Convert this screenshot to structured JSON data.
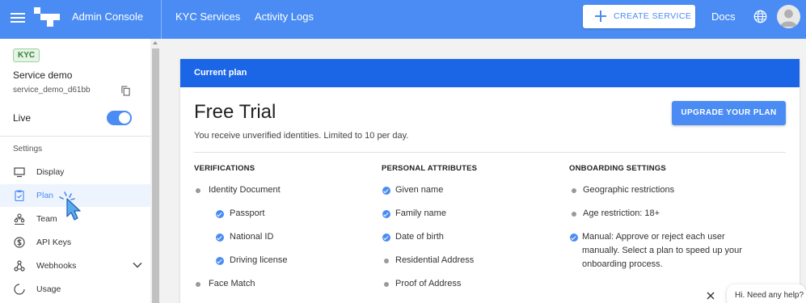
{
  "topbar": {
    "brand": "Admin Console",
    "nav": [
      "KYC Services",
      "Activity Logs"
    ],
    "create_service": "CREATE SERVICE",
    "docs": "Docs",
    "icons": [
      "menu-icon",
      "logo-icon",
      "plus-icon",
      "globe-icon",
      "avatar-icon"
    ]
  },
  "sidebar": {
    "badge": "KYC",
    "service_name": "Service demo",
    "service_id": "service_demo_d61bb",
    "live_label": "Live",
    "live_enabled": true,
    "settings_label": "Settings",
    "items": [
      {
        "label": "Display",
        "icon": "monitor-icon",
        "active": false
      },
      {
        "label": "Plan",
        "icon": "clipboard-icon",
        "active": true
      },
      {
        "label": "Team",
        "icon": "team-icon",
        "active": false
      },
      {
        "label": "API Keys",
        "icon": "dollar-circle-icon",
        "active": false
      },
      {
        "label": "Webhooks",
        "icon": "webhooks-icon",
        "active": false
      },
      {
        "label": "Usage",
        "icon": "usage-icon",
        "active": false
      }
    ]
  },
  "plan": {
    "header": "Current plan",
    "title": "Free Trial",
    "description": "You receive unverified identities. Limited to 10 per day.",
    "upgrade": "UPGRADE YOUR PLAN",
    "columns": [
      {
        "heading": "VERIFICATIONS",
        "rows": [
          {
            "text": "Identity Document",
            "kind": "dot",
            "indent": false
          },
          {
            "text": "Passport",
            "kind": "check",
            "indent": true
          },
          {
            "text": "National ID",
            "kind": "check",
            "indent": true
          },
          {
            "text": "Driving license",
            "kind": "check",
            "indent": true
          },
          {
            "text": "Face Match",
            "kind": "dot",
            "indent": false
          }
        ]
      },
      {
        "heading": "PERSONAL ATTRIBUTES",
        "rows": [
          {
            "text": "Given name",
            "kind": "check",
            "indent": false
          },
          {
            "text": "Family name",
            "kind": "check",
            "indent": false
          },
          {
            "text": "Date of birth",
            "kind": "check",
            "indent": false
          },
          {
            "text": "Residential Address",
            "kind": "dot",
            "indent": false
          },
          {
            "text": "Proof of Address",
            "kind": "dot",
            "indent": false
          }
        ]
      },
      {
        "heading": "ONBOARDING SETTINGS",
        "rows": [
          {
            "text": "Geographic restrictions",
            "kind": "dot",
            "indent": false
          },
          {
            "text": "Age restriction: 18+",
            "kind": "dot",
            "indent": false
          },
          {
            "text": "Manual: Approve or reject each user manually. Select a plan to speed up your onboarding process.",
            "kind": "check",
            "indent": false
          }
        ]
      }
    ]
  },
  "help": {
    "text": "Hi. Need any help?"
  },
  "colors": {
    "primary": "#4a8cf3",
    "header_dark": "#1a66e6",
    "badge_green": "#2e7d32"
  }
}
